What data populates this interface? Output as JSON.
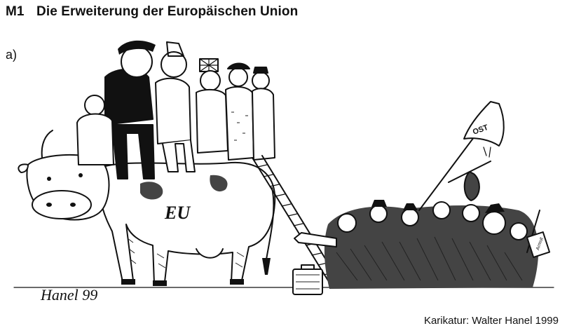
{
  "heading": {
    "number": "M1",
    "title": "Die Erweiterung der Europäischen Union"
  },
  "subheading": "a)",
  "cartoon": {
    "cow_label": "EU",
    "flag_text": "OST",
    "sign_text": "Armut",
    "signature": "Hanel 99"
  },
  "credit": "Karikatur: Walter Hanel 1999"
}
